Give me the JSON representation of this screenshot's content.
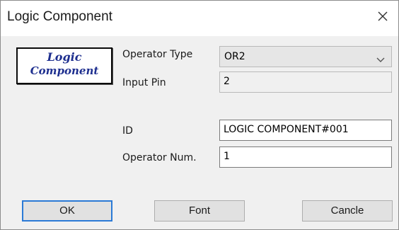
{
  "dialog": {
    "title": "Logic Component",
    "close_icon": "close-icon"
  },
  "logo": {
    "line1": "Logic",
    "line2": "Component",
    "color": "#1e2f8f"
  },
  "form": {
    "operator_type_label": "Operator Type",
    "operator_type_value": "OR2",
    "input_pin_label": "Input Pin",
    "input_pin_value": "2",
    "id_label": "ID",
    "id_value": "LOGIC COMPONENT#001",
    "operator_num_label": "Operator Num.",
    "operator_num_value": "1"
  },
  "buttons": {
    "ok": "OK",
    "font": "Font",
    "cancel": "Cancle"
  },
  "colors": {
    "accent": "#2b7ad6",
    "dialog_bg": "#f0f0f0"
  }
}
